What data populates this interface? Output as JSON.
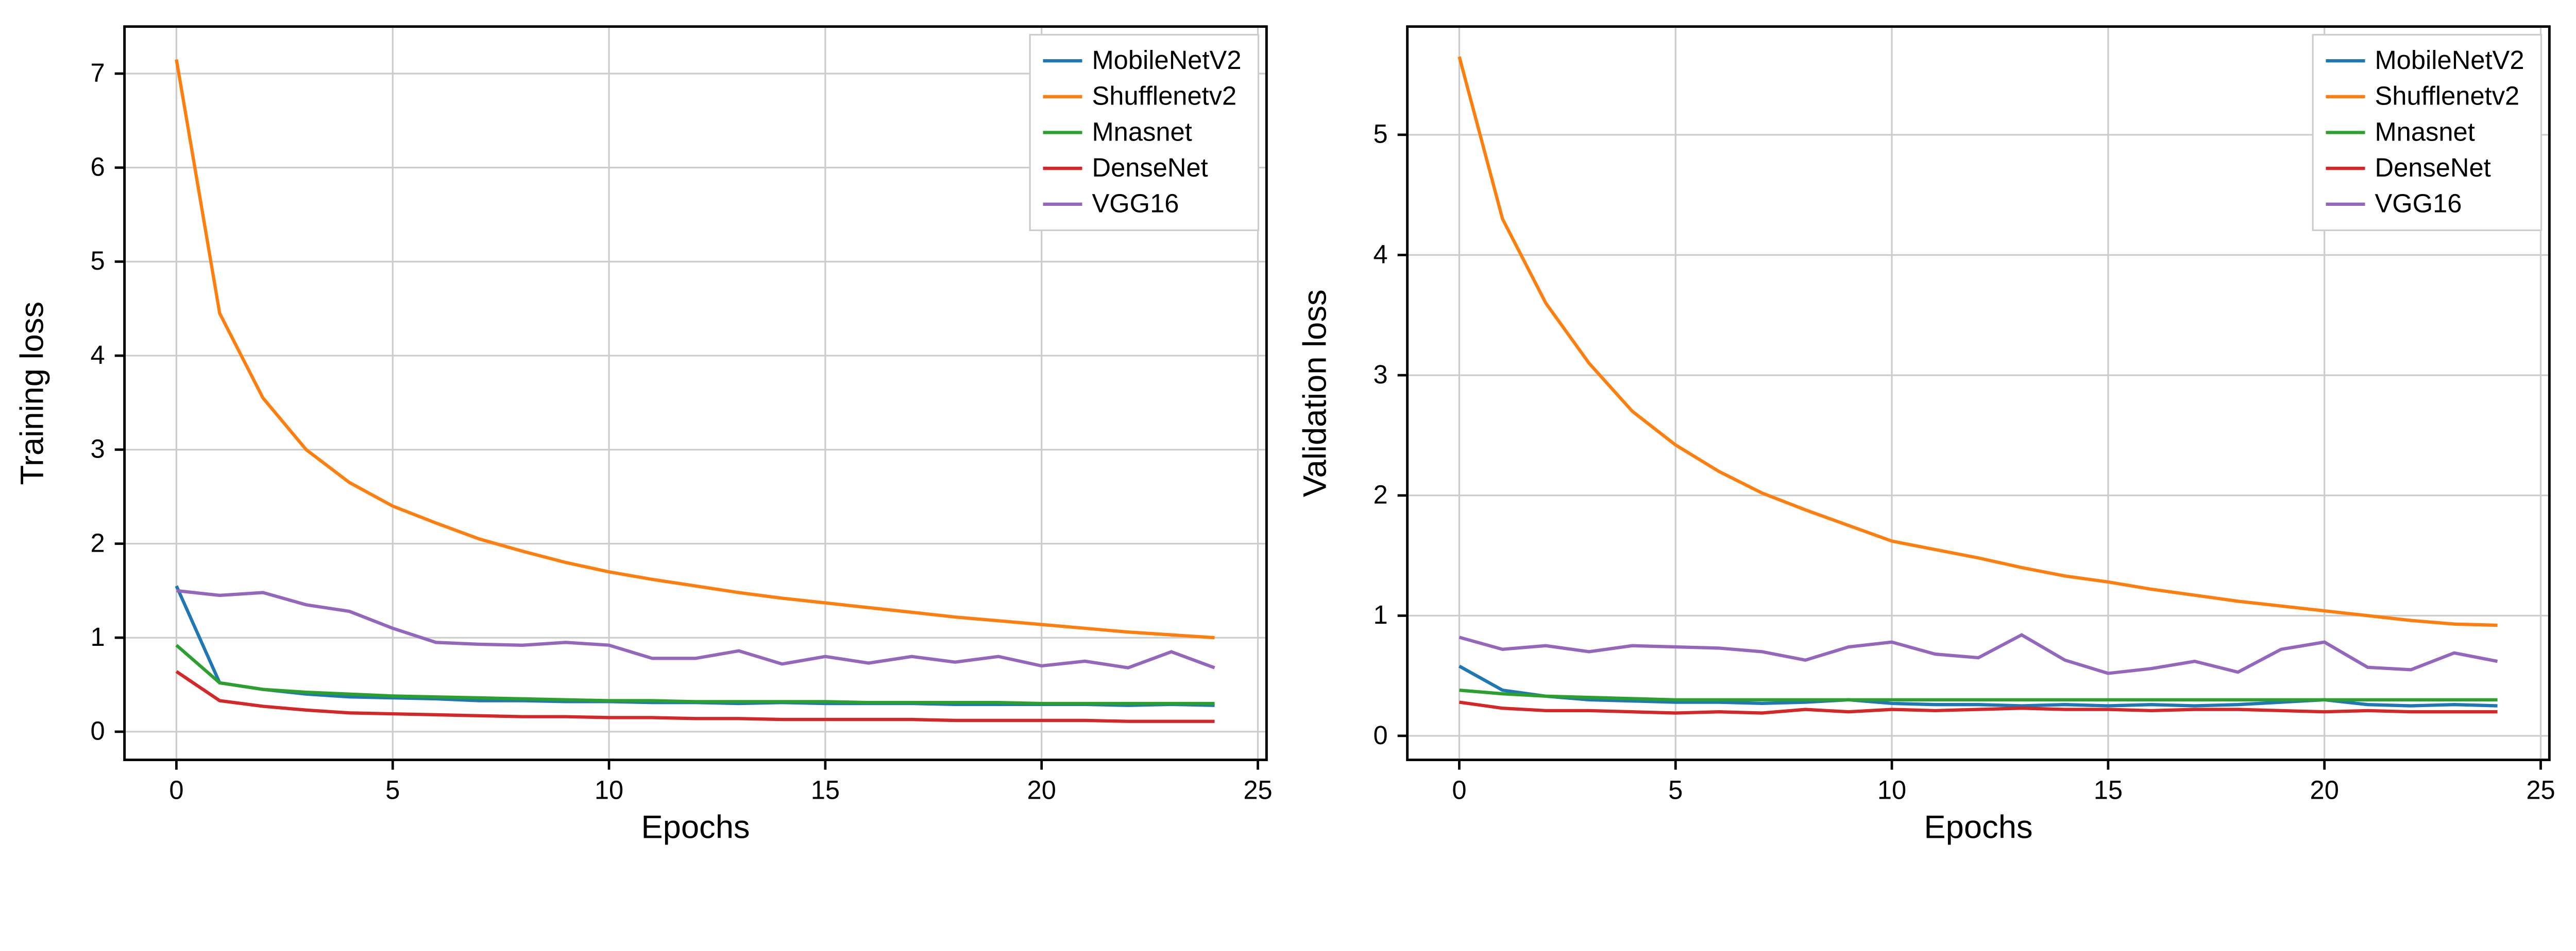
{
  "chart_data": [
    {
      "type": "line",
      "title": "",
      "xlabel": "Epochs",
      "ylabel": "Training loss",
      "xlim": [
        -1.2,
        25.2
      ],
      "ylim": [
        -0.3,
        7.5
      ],
      "xticks": [
        0,
        5,
        10,
        15,
        20,
        25
      ],
      "yticks": [
        0,
        1,
        2,
        3,
        4,
        5,
        6,
        7
      ],
      "x": [
        0,
        1,
        2,
        3,
        4,
        5,
        6,
        7,
        8,
        9,
        10,
        11,
        12,
        13,
        14,
        15,
        16,
        17,
        18,
        19,
        20,
        21,
        22,
        23,
        24
      ],
      "series": [
        {
          "name": "MobileNetV2",
          "color": "#1f77b4",
          "values": [
            1.55,
            0.52,
            0.45,
            0.4,
            0.37,
            0.36,
            0.35,
            0.33,
            0.33,
            0.32,
            0.32,
            0.31,
            0.31,
            0.3,
            0.31,
            0.3,
            0.3,
            0.3,
            0.29,
            0.29,
            0.29,
            0.29,
            0.28,
            0.29,
            0.28
          ]
        },
        {
          "name": "Shufflenetv2",
          "color": "#ff7f0e",
          "values": [
            7.15,
            4.45,
            3.55,
            3.0,
            2.65,
            2.4,
            2.22,
            2.05,
            1.92,
            1.8,
            1.7,
            1.62,
            1.55,
            1.48,
            1.42,
            1.37,
            1.32,
            1.27,
            1.22,
            1.18,
            1.14,
            1.1,
            1.06,
            1.03,
            1.0
          ]
        },
        {
          "name": "Mnasnet",
          "color": "#2ca02c",
          "values": [
            0.92,
            0.52,
            0.45,
            0.42,
            0.4,
            0.38,
            0.37,
            0.36,
            0.35,
            0.34,
            0.33,
            0.33,
            0.32,
            0.32,
            0.32,
            0.32,
            0.31,
            0.31,
            0.31,
            0.31,
            0.3,
            0.3,
            0.3,
            0.3,
            0.3
          ]
        },
        {
          "name": "DenseNet",
          "color": "#d62728",
          "values": [
            0.64,
            0.33,
            0.27,
            0.23,
            0.2,
            0.19,
            0.18,
            0.17,
            0.16,
            0.16,
            0.15,
            0.15,
            0.14,
            0.14,
            0.13,
            0.13,
            0.13,
            0.13,
            0.12,
            0.12,
            0.12,
            0.12,
            0.11,
            0.11,
            0.11
          ]
        },
        {
          "name": "VGG16",
          "color": "#9467bd",
          "values": [
            1.5,
            1.45,
            1.48,
            1.35,
            1.28,
            1.1,
            0.95,
            0.93,
            0.92,
            0.95,
            0.92,
            0.78,
            0.78,
            0.86,
            0.72,
            0.8,
            0.73,
            0.8,
            0.74,
            0.8,
            0.7,
            0.75,
            0.68,
            0.85,
            0.68
          ]
        }
      ],
      "legend_pos": "upper-right"
    },
    {
      "type": "line",
      "title": "",
      "xlabel": "Epochs",
      "ylabel": "Validation loss",
      "xlim": [
        -1.2,
        25.2
      ],
      "ylim": [
        -0.2,
        5.9
      ],
      "xticks": [
        0,
        5,
        10,
        15,
        20,
        25
      ],
      "yticks": [
        0,
        1,
        2,
        3,
        4,
        5
      ],
      "x": [
        0,
        1,
        2,
        3,
        4,
        5,
        6,
        7,
        8,
        9,
        10,
        11,
        12,
        13,
        14,
        15,
        16,
        17,
        18,
        19,
        20,
        21,
        22,
        23,
        24
      ],
      "series": [
        {
          "name": "MobileNetV2",
          "color": "#1f77b4",
          "values": [
            0.58,
            0.38,
            0.33,
            0.3,
            0.29,
            0.28,
            0.28,
            0.27,
            0.28,
            0.3,
            0.27,
            0.26,
            0.26,
            0.25,
            0.26,
            0.25,
            0.26,
            0.25,
            0.26,
            0.28,
            0.3,
            0.26,
            0.25,
            0.26,
            0.25
          ]
        },
        {
          "name": "Shufflenetv2",
          "color": "#ff7f0e",
          "values": [
            5.65,
            4.3,
            3.6,
            3.1,
            2.7,
            2.42,
            2.2,
            2.02,
            1.88,
            1.75,
            1.62,
            1.55,
            1.48,
            1.4,
            1.33,
            1.28,
            1.22,
            1.17,
            1.12,
            1.08,
            1.04,
            1.0,
            0.96,
            0.93,
            0.92
          ]
        },
        {
          "name": "Mnasnet",
          "color": "#2ca02c",
          "values": [
            0.38,
            0.35,
            0.33,
            0.32,
            0.31,
            0.3,
            0.3,
            0.3,
            0.3,
            0.3,
            0.3,
            0.3,
            0.3,
            0.3,
            0.3,
            0.3,
            0.3,
            0.3,
            0.3,
            0.3,
            0.3,
            0.3,
            0.3,
            0.3,
            0.3
          ]
        },
        {
          "name": "DenseNet",
          "color": "#d62728",
          "values": [
            0.28,
            0.23,
            0.21,
            0.21,
            0.2,
            0.19,
            0.2,
            0.19,
            0.22,
            0.2,
            0.22,
            0.21,
            0.22,
            0.23,
            0.22,
            0.22,
            0.21,
            0.22,
            0.22,
            0.21,
            0.2,
            0.21,
            0.2,
            0.2,
            0.2
          ]
        },
        {
          "name": "VGG16",
          "color": "#9467bd",
          "values": [
            0.82,
            0.72,
            0.75,
            0.7,
            0.75,
            0.74,
            0.73,
            0.7,
            0.63,
            0.74,
            0.78,
            0.68,
            0.65,
            0.84,
            0.63,
            0.52,
            0.56,
            0.62,
            0.53,
            0.72,
            0.78,
            0.57,
            0.55,
            0.69,
            0.62
          ]
        }
      ],
      "legend_pos": "upper-right"
    }
  ]
}
